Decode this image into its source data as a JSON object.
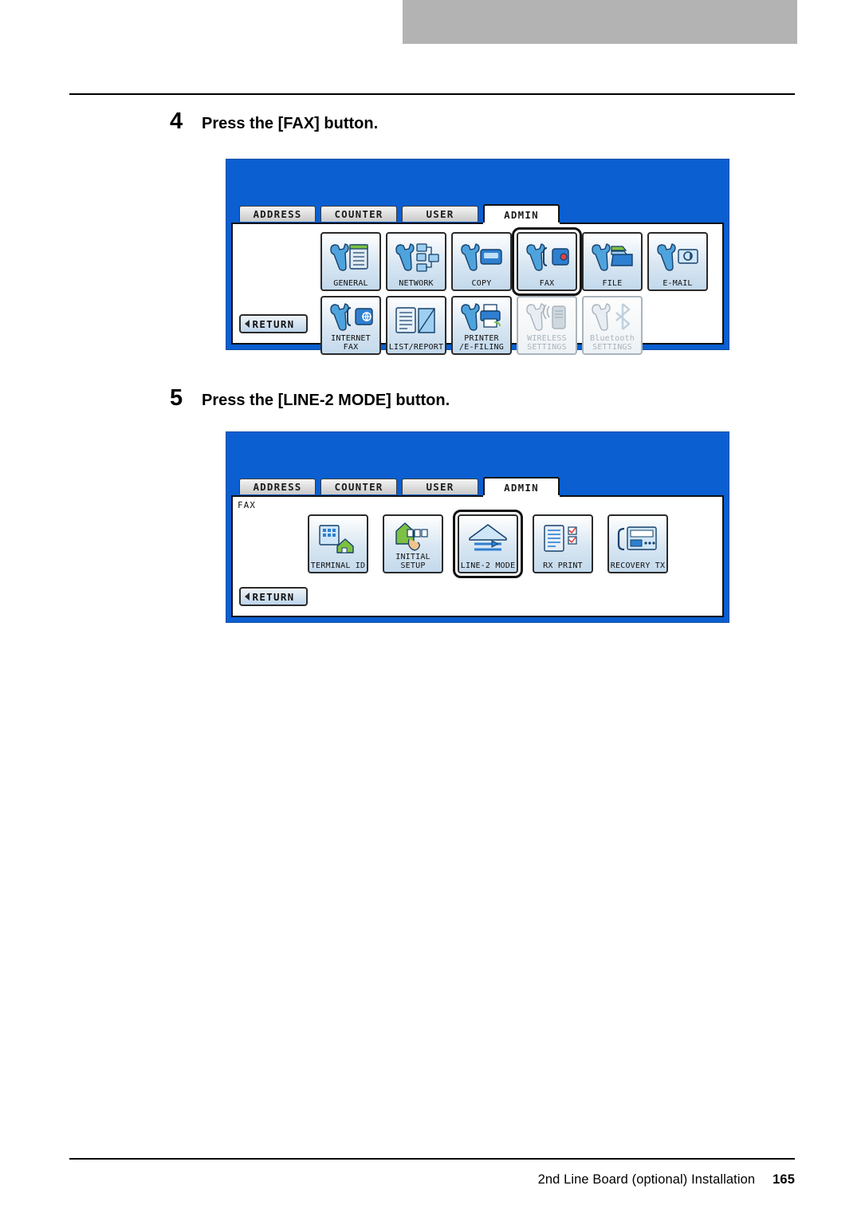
{
  "document": {
    "footer_title": "2nd Line Board (optional) Installation",
    "page_number": "165"
  },
  "steps": [
    {
      "number": "4",
      "text": "Press the [FAX] button."
    },
    {
      "number": "5",
      "text": "Press the [LINE-2 MODE] button."
    }
  ],
  "screens": [
    {
      "name": "admin-menu-screen",
      "tabs": [
        {
          "label": "ADDRESS",
          "active": false
        },
        {
          "label": "COUNTER",
          "active": false
        },
        {
          "label": "USER",
          "active": false
        },
        {
          "label": "ADMIN",
          "active": true
        }
      ],
      "body_label": "",
      "buttons": [
        {
          "label": "GENERAL",
          "icon": "wrench-document-icon",
          "selected": false,
          "disabled": false
        },
        {
          "label": "NETWORK",
          "icon": "wrench-network-icon",
          "selected": false,
          "disabled": false
        },
        {
          "label": "COPY",
          "icon": "wrench-copy-icon",
          "selected": false,
          "disabled": false
        },
        {
          "label": "FAX",
          "icon": "wrench-fax-icon",
          "selected": true,
          "disabled": false
        },
        {
          "label": "FILE",
          "icon": "wrench-folder-icon",
          "selected": false,
          "disabled": false
        },
        {
          "label": "E-MAIL",
          "icon": "wrench-email-icon",
          "selected": false,
          "disabled": false
        },
        {
          "label": "INTERNET FAX",
          "icon": "wrench-internet-fax-icon",
          "selected": false,
          "disabled": false
        },
        {
          "label": "LIST/REPORT",
          "icon": "list-report-icon",
          "selected": false,
          "disabled": false
        },
        {
          "label": "PRINTER\n/E-FILING",
          "icon": "wrench-printer-efiling-icon",
          "selected": false,
          "disabled": false
        },
        {
          "label": "WIRELESS\nSETTINGS",
          "icon": "wireless-settings-icon",
          "selected": false,
          "disabled": true
        },
        {
          "label": "Bluetooth\nSETTINGS",
          "icon": "bluetooth-settings-icon",
          "selected": false,
          "disabled": true
        }
      ],
      "return_label": "RETURN"
    },
    {
      "name": "fax-admin-screen",
      "tabs": [
        {
          "label": "ADDRESS",
          "active": false
        },
        {
          "label": "COUNTER",
          "active": false
        },
        {
          "label": "USER",
          "active": false
        },
        {
          "label": "ADMIN",
          "active": true
        }
      ],
      "body_label": "FAX",
      "buttons": [
        {
          "label": "TERMINAL ID",
          "icon": "terminal-id-icon",
          "selected": false,
          "disabled": false
        },
        {
          "label": "INITIAL SETUP",
          "icon": "initial-setup-icon",
          "selected": false,
          "disabled": false
        },
        {
          "label": "LINE-2 MODE",
          "icon": "line2-mode-icon",
          "selected": true,
          "disabled": false
        },
        {
          "label": "RX PRINT",
          "icon": "rx-print-icon",
          "selected": false,
          "disabled": false
        },
        {
          "label": "RECOVERY TX",
          "icon": "recovery-tx-icon",
          "selected": false,
          "disabled": false
        }
      ],
      "return_label": "RETURN"
    }
  ]
}
